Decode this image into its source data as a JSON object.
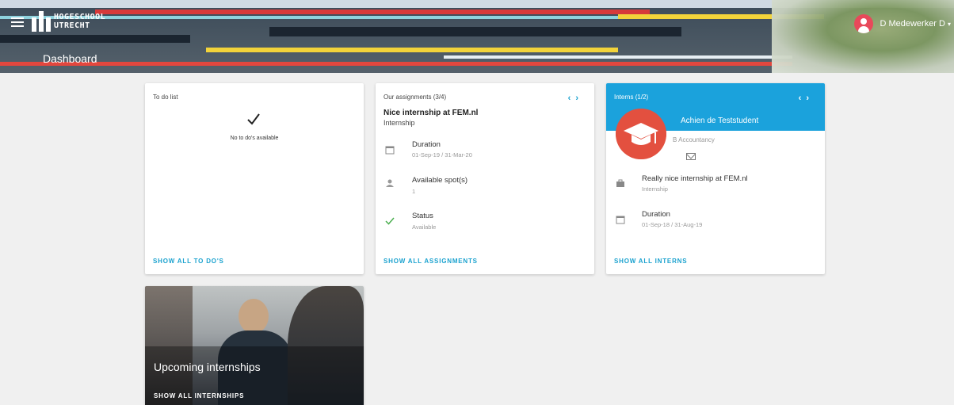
{
  "header": {
    "logo_text_line1": "HOGESCHOOL",
    "logo_text_line2": "UTRECHT",
    "page_title": "Dashboard",
    "user_name": "D Medewerker D",
    "user_menu_icon": "chevron-down-icon"
  },
  "todo": {
    "title": "To do list",
    "empty_text": "No to do's available",
    "link": "SHOW ALL TO DO'S"
  },
  "assignments": {
    "title": "Our assignments",
    "count": "(3/4)",
    "prev": "‹",
    "next": "›",
    "name": "Nice internship at FEM.nl",
    "type": "Internship",
    "rows": [
      {
        "icon": "calendar-icon",
        "label": "Duration",
        "value": "01-Sep-19 / 31-Mar-20"
      },
      {
        "icon": "person-icon",
        "label": "Available spot(s)",
        "value": "1"
      },
      {
        "icon": "check-icon",
        "label": "Status",
        "value": "Available"
      }
    ],
    "link": "SHOW ALL ASSIGNMENTS"
  },
  "interns": {
    "title": "Interns",
    "count": "(1/2)",
    "prev": "‹",
    "next": "›",
    "name": "Achien de Teststudent",
    "study": "B Accountancy",
    "rows": [
      {
        "icon": "briefcase-icon",
        "label": "Really nice internship at FEM.nl",
        "value": "Internship"
      },
      {
        "icon": "calendar-icon",
        "label": "Duration",
        "value": "01-Sep-18 / 31-Aug-19"
      }
    ],
    "link": "SHOW ALL INTERNS"
  },
  "upcoming": {
    "title": "Upcoming internships",
    "link": "SHOW ALL INTERNSHIPS"
  },
  "colors": {
    "accent": "#1ba2dc",
    "avatar_red": "#e3503f",
    "status_green": "#4caf50"
  }
}
